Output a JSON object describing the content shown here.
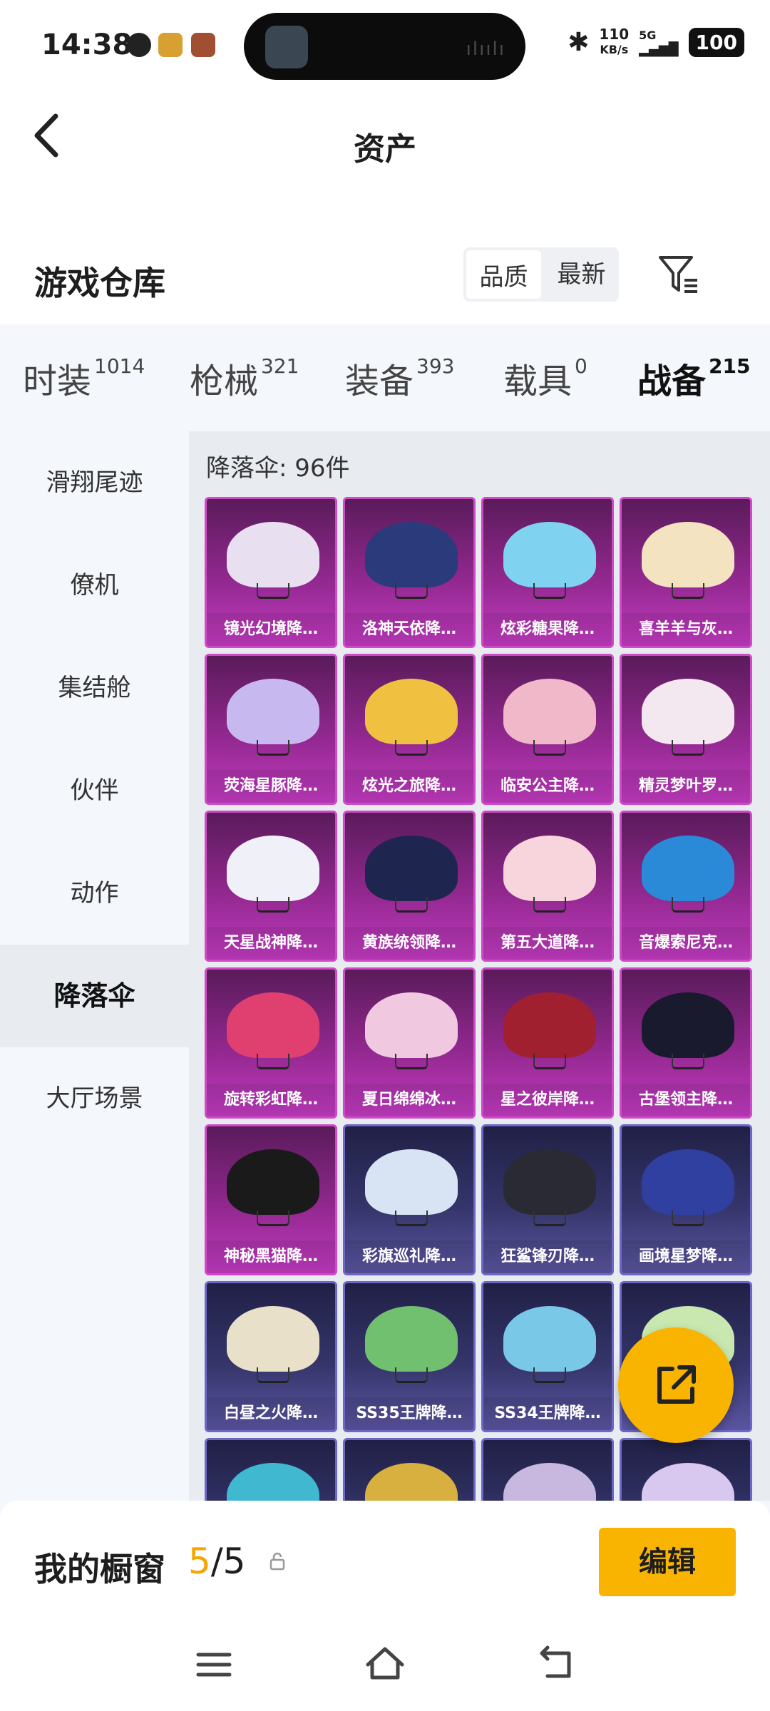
{
  "status": {
    "time": "14:38",
    "net_speed": "110",
    "net_unit": "KB/s",
    "signal_label": "5G",
    "battery": "100"
  },
  "topbar": {
    "title": "资产"
  },
  "header": {
    "title": "游戏仓库",
    "sort_options": [
      "品质",
      "最新"
    ],
    "sort_selected": "品质"
  },
  "tabs": [
    {
      "label": "时装",
      "count": "1014"
    },
    {
      "label": "枪械",
      "count": "321"
    },
    {
      "label": "装备",
      "count": "393"
    },
    {
      "label": "载具",
      "count": "0"
    },
    {
      "label": "战备",
      "count": "215",
      "active": true
    }
  ],
  "sidebar": {
    "items": [
      "滑翔尾迹",
      "僚机",
      "集结舱",
      "伙伴",
      "动作",
      "降落伞",
      "大厅场景"
    ],
    "active": "降落伞"
  },
  "main": {
    "count_label": "降落伞: 96件",
    "items": [
      {
        "name": "镜光幻境降…",
        "tier": "purple",
        "color": "#e8e0f0"
      },
      {
        "name": "洛神天依降…",
        "tier": "purple",
        "color": "#2b3a7a"
      },
      {
        "name": "炫彩糖果降…",
        "tier": "purple",
        "color": "#7fd3f0"
      },
      {
        "name": "喜羊羊与灰…",
        "tier": "purple",
        "color": "#f4e3c0"
      },
      {
        "name": "荧海星豚降…",
        "tier": "purple",
        "color": "#c8b8f0"
      },
      {
        "name": "炫光之旅降…",
        "tier": "purple",
        "color": "#f0c040"
      },
      {
        "name": "临安公主降…",
        "tier": "purple",
        "color": "#f0b8c8"
      },
      {
        "name": "精灵梦叶罗…",
        "tier": "purple",
        "color": "#f4e8f0"
      },
      {
        "name": "天星战神降…",
        "tier": "purple",
        "color": "#f0f0f8"
      },
      {
        "name": "黄族统领降…",
        "tier": "purple",
        "color": "#1e2650"
      },
      {
        "name": "第五大道降…",
        "tier": "purple",
        "color": "#f8d4dc"
      },
      {
        "name": "音爆索尼克…",
        "tier": "purple",
        "color": "#2a8ad8"
      },
      {
        "name": "旋转彩虹降…",
        "tier": "purple",
        "color": "#e04070"
      },
      {
        "name": "夏日绵绵冰…",
        "tier": "purple",
        "color": "#f0c8e0"
      },
      {
        "name": "星之彼岸降…",
        "tier": "purple",
        "color": "#a02030"
      },
      {
        "name": "古堡领主降…",
        "tier": "purple",
        "color": "#1a1a2e"
      },
      {
        "name": "神秘黑猫降…",
        "tier": "purple",
        "color": "#1a1a1a"
      },
      {
        "name": "彩旗巡礼降…",
        "tier": "blue",
        "color": "#d8e4f4"
      },
      {
        "name": "狂鲨锋刃降…",
        "tier": "blue",
        "color": "#2a2a34"
      },
      {
        "name": "画境星梦降…",
        "tier": "blue",
        "color": "#3040a0"
      },
      {
        "name": "白昼之火降…",
        "tier": "blue",
        "color": "#e8e0c8"
      },
      {
        "name": "SS35王牌降…",
        "tier": "blue",
        "color": "#70c070"
      },
      {
        "name": "SS34王牌降…",
        "tier": "blue",
        "color": "#7ac8e8"
      },
      {
        "name": "",
        "tier": "blue",
        "color": "#c8e8b0"
      },
      {
        "name": "",
        "tier": "blue",
        "color": "#40b8d0"
      },
      {
        "name": "",
        "tier": "blue",
        "color": "#d8b040"
      },
      {
        "name": "",
        "tier": "blue",
        "color": "#c8b8e0"
      },
      {
        "name": "",
        "tier": "blue",
        "color": "#d8c8f0"
      }
    ]
  },
  "showcase": {
    "label": "我的橱窗",
    "current": "5",
    "total": "/5",
    "edit_label": "编辑"
  },
  "colors": {
    "accent": "#f8b400",
    "purple_tier": "#c13bc0",
    "blue_tier": "#5a55a0"
  },
  "icons": {
    "back": "back-arrow-icon",
    "filter": "filter-icon",
    "fab": "external-link-icon",
    "lock": "lock-icon"
  }
}
